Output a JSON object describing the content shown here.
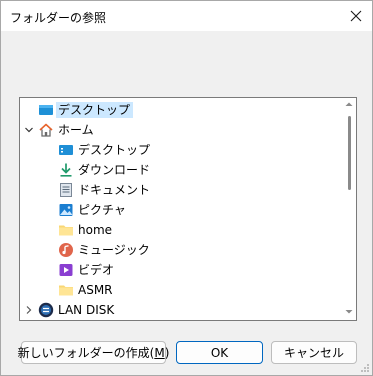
{
  "window": {
    "title": "フォルダーの参照",
    "close_glyph": "✕",
    "prompt": ""
  },
  "tree": {
    "items": [
      {
        "label": "デスクトップ",
        "icon": "desktop-icon",
        "level": 0,
        "expander": "none",
        "selected": true
      },
      {
        "label": "ホーム",
        "icon": "home-icon",
        "level": 0,
        "expander": "expanded",
        "selected": false
      },
      {
        "label": "デスクトップ",
        "icon": "desktop-folder-icon",
        "level": 1,
        "expander": "none",
        "selected": false
      },
      {
        "label": "ダウンロード",
        "icon": "download-icon",
        "level": 1,
        "expander": "none",
        "selected": false
      },
      {
        "label": "ドキュメント",
        "icon": "document-icon",
        "level": 1,
        "expander": "none",
        "selected": false
      },
      {
        "label": "ピクチャ",
        "icon": "pictures-icon",
        "level": 1,
        "expander": "none",
        "selected": false
      },
      {
        "label": "home",
        "icon": "folder-icon",
        "level": 1,
        "expander": "none",
        "selected": false
      },
      {
        "label": "ミュージック",
        "icon": "music-icon",
        "level": 1,
        "expander": "none",
        "selected": false
      },
      {
        "label": "ビデオ",
        "icon": "video-icon",
        "level": 1,
        "expander": "none",
        "selected": false
      },
      {
        "label": "ASMR",
        "icon": "folder-icon",
        "level": 1,
        "expander": "none",
        "selected": false
      },
      {
        "label": "LAN DISK",
        "icon": "lan-disk-icon",
        "level": 0,
        "expander": "collapsed",
        "selected": false
      }
    ]
  },
  "buttons": {
    "new_folder_prefix": "新しいフォルダーの作成(",
    "new_folder_accel": "M",
    "new_folder_suffix": ")",
    "ok": "OK",
    "cancel": "キャンセル"
  },
  "colors": {
    "selection": "#cce8ff",
    "primary_border": "#0067c0",
    "folder_yellow": "#f8d775",
    "accent_blue": "#0078d4"
  }
}
